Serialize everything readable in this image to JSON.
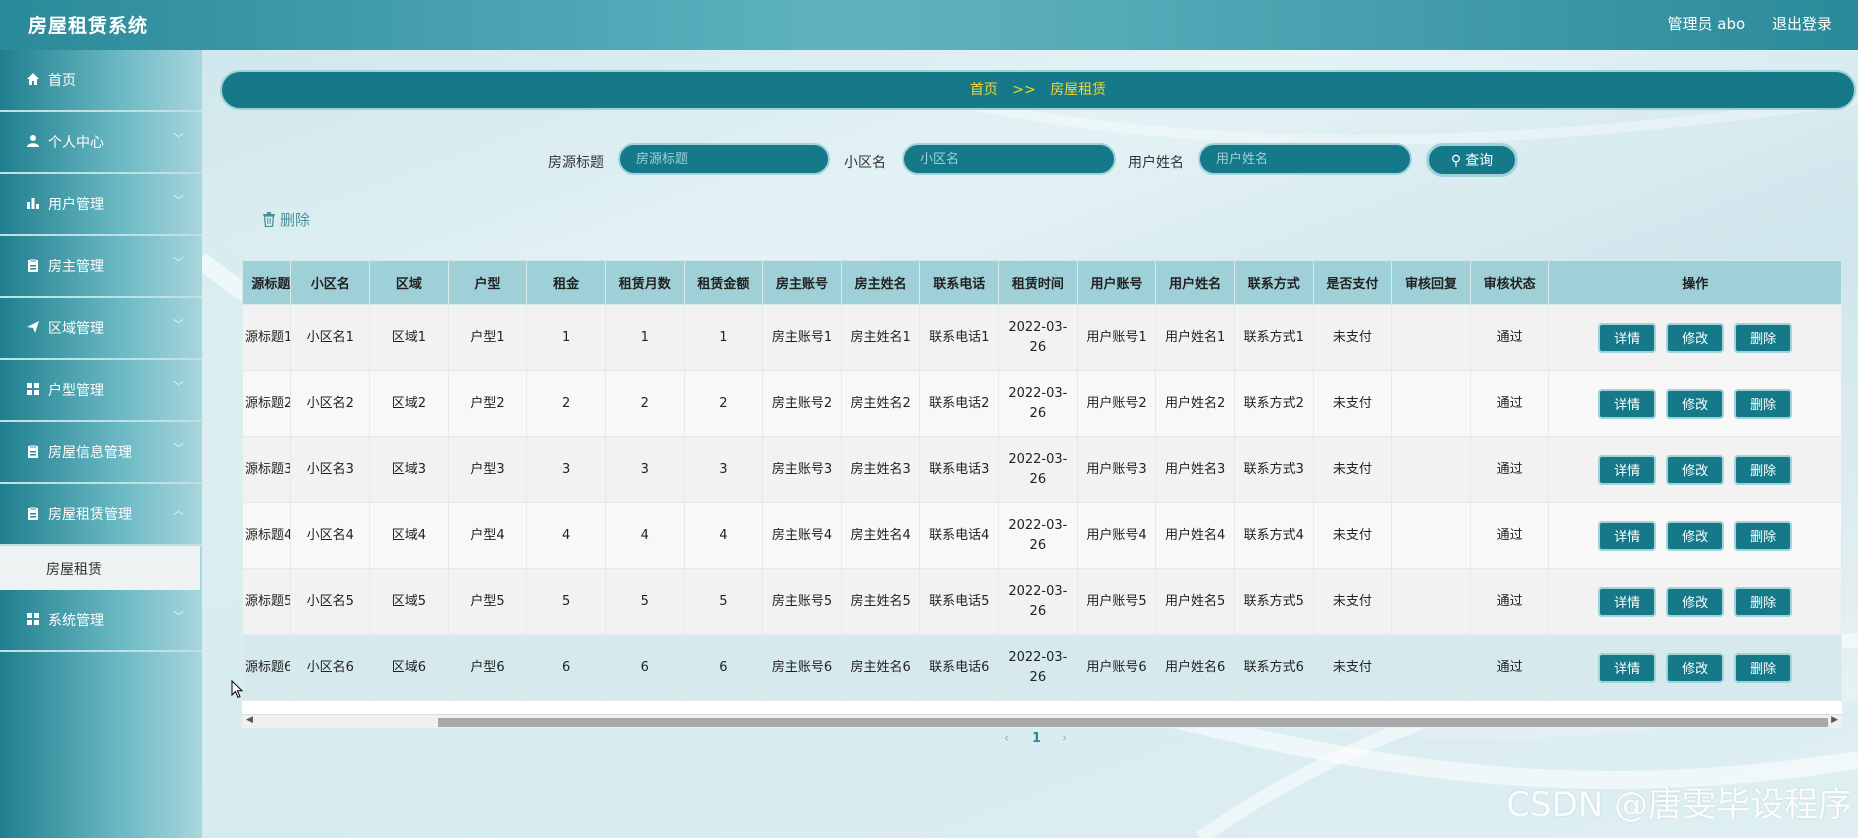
{
  "app": {
    "title": "房屋租赁系统"
  },
  "header": {
    "user": "管理员 abo",
    "logout": "退出登录"
  },
  "sidebar": {
    "items": [
      {
        "label": "首页",
        "icon": "home-icon",
        "has_children": false
      },
      {
        "label": "个人中心",
        "icon": "user-icon",
        "has_children": true
      },
      {
        "label": "用户管理",
        "icon": "bar-chart-icon",
        "has_children": true
      },
      {
        "label": "房主管理",
        "icon": "clipboard-icon",
        "has_children": true
      },
      {
        "label": "区域管理",
        "icon": "send-icon",
        "has_children": true
      },
      {
        "label": "户型管理",
        "icon": "grid-icon",
        "has_children": true
      },
      {
        "label": "房屋信息管理",
        "icon": "clipboard-icon",
        "has_children": true
      },
      {
        "label": "房屋租赁管理",
        "icon": "clipboard-icon",
        "has_children": true
      }
    ],
    "sub_item": {
      "label": "房屋租赁"
    },
    "last_item": {
      "label": "系统管理",
      "icon": "grid-icon",
      "has_children": true
    }
  },
  "breadcrumb": {
    "home": "首页",
    "sep": ">>",
    "current": "房屋租赁"
  },
  "search": {
    "title_label": "房源标题",
    "title_placeholder": "房源标题",
    "community_label": "小区名",
    "community_placeholder": "小区名",
    "user_label": "用户姓名",
    "user_placeholder": "用户姓名",
    "query_button": "查询"
  },
  "toolbar": {
    "delete_label": "删除"
  },
  "table": {
    "columns": [
      "源标题",
      "小区名",
      "区域",
      "户型",
      "租金",
      "租赁月数",
      "租赁金额",
      "房主账号",
      "房主姓名",
      "联系电话",
      "租赁时间",
      "用户账号",
      "用户姓名",
      "联系方式",
      "是否支付",
      "审核回复",
      "审核状态",
      "操作"
    ],
    "rows": [
      {
        "title": "源标题1",
        "community": "小区名1",
        "region": "区域1",
        "layout": "户型1",
        "rent": "1",
        "months": "1",
        "amount": "1",
        "owner_account": "房主账号1",
        "owner_name": "房主姓名1",
        "phone": "联系电话1",
        "time": "2022-03-26",
        "user_account": "用户账号1",
        "user_name": "用户姓名1",
        "contact": "联系方式1",
        "paid": "未支付",
        "reply": "",
        "status": "通过"
      },
      {
        "title": "源标题2",
        "community": "小区名2",
        "region": "区域2",
        "layout": "户型2",
        "rent": "2",
        "months": "2",
        "amount": "2",
        "owner_account": "房主账号2",
        "owner_name": "房主姓名2",
        "phone": "联系电话2",
        "time": "2022-03-26",
        "user_account": "用户账号2",
        "user_name": "用户姓名2",
        "contact": "联系方式2",
        "paid": "未支付",
        "reply": "",
        "status": "通过"
      },
      {
        "title": "源标题3",
        "community": "小区名3",
        "region": "区域3",
        "layout": "户型3",
        "rent": "3",
        "months": "3",
        "amount": "3",
        "owner_account": "房主账号3",
        "owner_name": "房主姓名3",
        "phone": "联系电话3",
        "time": "2022-03-26",
        "user_account": "用户账号3",
        "user_name": "用户姓名3",
        "contact": "联系方式3",
        "paid": "未支付",
        "reply": "",
        "status": "通过"
      },
      {
        "title": "源标题4",
        "community": "小区名4",
        "region": "区域4",
        "layout": "户型4",
        "rent": "4",
        "months": "4",
        "amount": "4",
        "owner_account": "房主账号4",
        "owner_name": "房主姓名4",
        "phone": "联系电话4",
        "time": "2022-03-26",
        "user_account": "用户账号4",
        "user_name": "用户姓名4",
        "contact": "联系方式4",
        "paid": "未支付",
        "reply": "",
        "status": "通过"
      },
      {
        "title": "源标题5",
        "community": "小区名5",
        "region": "区域5",
        "layout": "户型5",
        "rent": "5",
        "months": "5",
        "amount": "5",
        "owner_account": "房主账号5",
        "owner_name": "房主姓名5",
        "phone": "联系电话5",
        "time": "2022-03-26",
        "user_account": "用户账号5",
        "user_name": "用户姓名5",
        "contact": "联系方式5",
        "paid": "未支付",
        "reply": "",
        "status": "通过"
      },
      {
        "title": "源标题6",
        "community": "小区名6",
        "region": "区域6",
        "layout": "户型6",
        "rent": "6",
        "months": "6",
        "amount": "6",
        "owner_account": "房主账号6",
        "owner_name": "房主姓名6",
        "phone": "联系电话6",
        "time": "2022-03-26",
        "user_account": "用户账号6",
        "user_name": "用户姓名6",
        "contact": "联系方式6",
        "paid": "未支付",
        "reply": "",
        "status": "通过"
      }
    ],
    "row_actions": {
      "detail": "详情",
      "edit": "修改",
      "delete": "删除"
    }
  },
  "pagination": {
    "prev": "‹",
    "current": "1",
    "next": "›"
  },
  "watermark": "CSDN @唐雯毕设程序",
  "colors": {
    "primary": "#16798a",
    "accent": "#f5d334",
    "header_bg": "#9fd0d8"
  }
}
